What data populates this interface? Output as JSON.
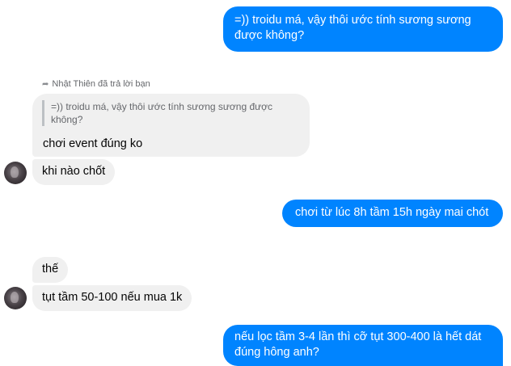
{
  "messages": {
    "m1": {
      "line1": "=)) troidu má, vậy thôi ước tính sương sương",
      "line2": "được không?"
    },
    "reply_note": "Nhật Thiên đã trả lời bạn",
    "reply_quote": "=)) troidu má, vậy thôi ước tính sương sương được không?",
    "m2": "chơi event đúng ko",
    "m3": "khi nào chốt",
    "m4": "chơi từ lúc 8h tầm 15h ngày mai chót",
    "m5": "thế",
    "m6": "tụt tầm 50-100 nếu mua 1k",
    "m7": {
      "line1": "nếu lọc tầm 3-4 lần thì cỡ tụt 300-400 là hết dát",
      "line2": "đúng hông anh?"
    }
  },
  "colors": {
    "outgoing": "#0084ff",
    "incoming": "#f0f0f0"
  },
  "icons": {
    "reply": "reply-arrow-icon",
    "avatar": "contact-avatar"
  }
}
